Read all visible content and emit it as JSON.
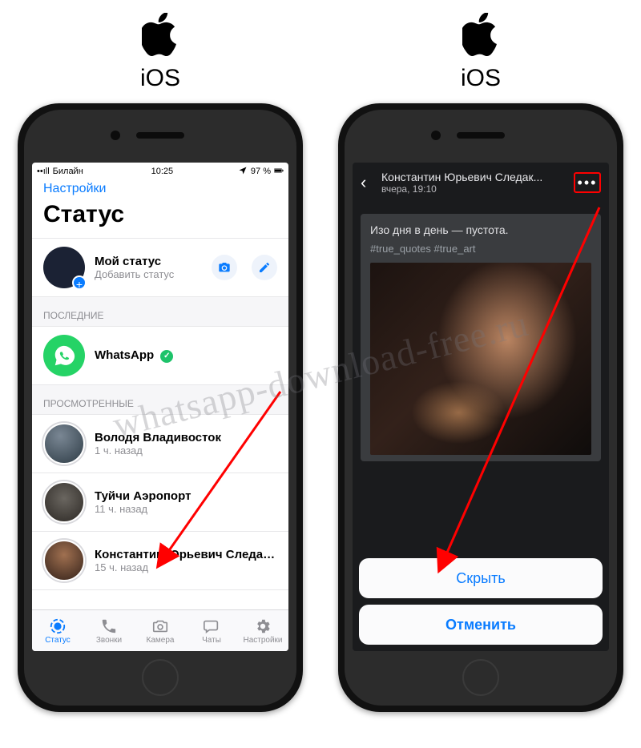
{
  "labels": {
    "ios": "iOS"
  },
  "watermark": "whatsapp-download-free.ru",
  "left": {
    "status": {
      "carrier": "Билайн",
      "time": "10:25",
      "battery": "97 %"
    },
    "nav_back": "Настройки",
    "title": "Статус",
    "my_status": {
      "title": "Мой статус",
      "sub": "Добавить статус"
    },
    "section_recent": "ПОСЛЕДНИЕ",
    "whatsapp": "WhatsApp",
    "section_viewed": "ПРОСМОТРЕННЫЕ",
    "items": [
      {
        "name": "Володя Владивосток",
        "time": "1 ч. назад"
      },
      {
        "name": "Туйчи Аэропорт",
        "time": "11 ч. назад"
      },
      {
        "name": "Константин Юрьевич Следак...",
        "time": "15 ч. назад"
      }
    ],
    "tabs": {
      "status": "Статус",
      "calls": "Звонки",
      "camera": "Камера",
      "chats": "Чаты",
      "settings": "Настройки"
    }
  },
  "right": {
    "header": {
      "name": "Константин Юрьевич Следак...",
      "time": "вчера, 19:10"
    },
    "story_text": "Изо дня в день — пустота.",
    "story_tags": "#true_quotes #true_art",
    "sheet": {
      "hide": "Скрыть",
      "cancel": "Отменить"
    }
  }
}
